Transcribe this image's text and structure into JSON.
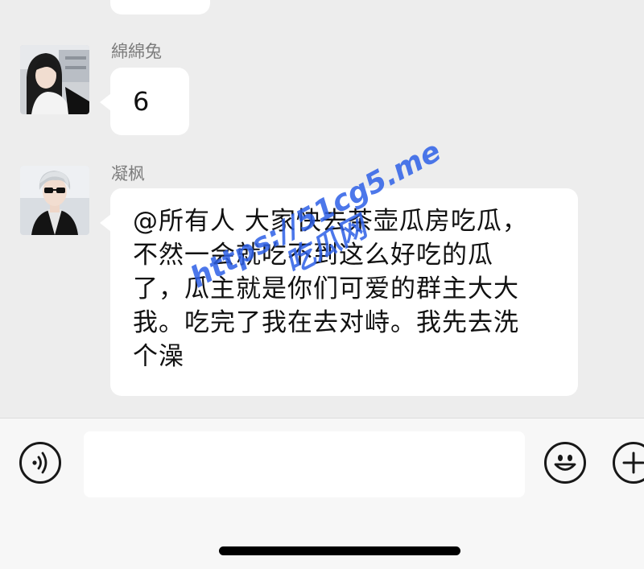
{
  "colors": {
    "background": "#ededed",
    "bubble": "#ffffff",
    "sender_name": "#7d7d7d",
    "watermark": "#2d5fe6",
    "input_bar": "#f7f7f7"
  },
  "messages": [
    {
      "sender": "綿綿兔",
      "text": "6"
    },
    {
      "sender": "凝枫",
      "text": "@所有人 大家快去茶壶瓜房吃瓜，\n不然一会就吃不到这么好吃的瓜\n了，瓜主就是你们可爱的群主大大\n我。吃完了我在去对峙。我先去洗\n个澡"
    }
  ],
  "watermark": {
    "line1": "https://51cg5.me",
    "line2": "吃瓜网"
  },
  "input_bar": {
    "voice_icon": "voice-icon",
    "emoji_icon": "emoji-icon",
    "plus_icon": "plus-icon"
  }
}
